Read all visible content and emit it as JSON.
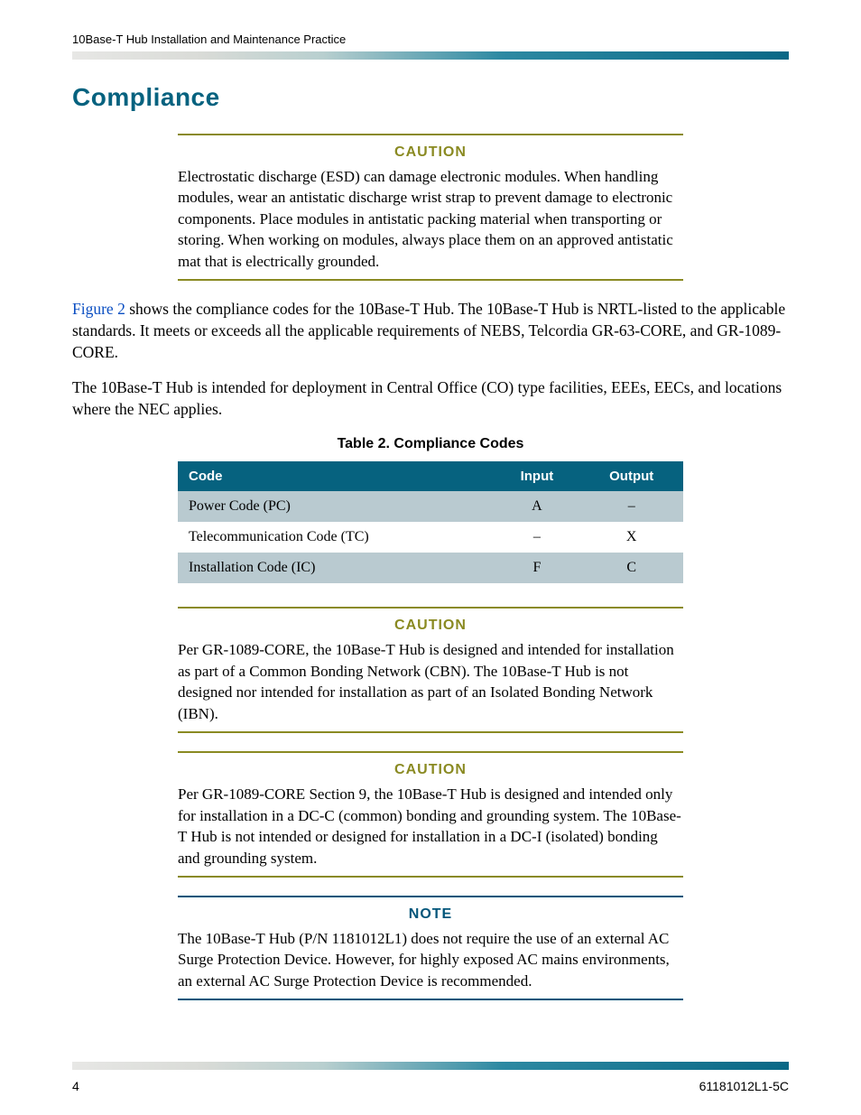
{
  "header": {
    "running": "10Base-T Hub Installation and Maintenance Practice"
  },
  "section_title": "Compliance",
  "caution1": {
    "label": "CAUTION",
    "body": "Electrostatic discharge (ESD) can damage electronic modules. When handling modules, wear an antistatic discharge wrist strap to prevent damage to electronic components. Place modules in antistatic packing material when transporting or storing. When working on modules, always place them on an approved antistatic mat that is electrically grounded."
  },
  "para1": {
    "figref": "Figure 2",
    "rest": " shows the compliance codes for the 10Base-T Hub. The 10Base-T Hub is NRTL-listed to the applicable standards. It meets or exceeds all the applicable requirements of NEBS, Telcordia GR-63-CORE, and GR-1089-CORE."
  },
  "para2": "The 10Base-T Hub is intended for deployment in Central Office (CO) type facilities, EEEs, EECs, and locations where the NEC applies.",
  "table": {
    "title": "Table 2.  Compliance Codes",
    "headers": {
      "code": "Code",
      "input": "Input",
      "output": "Output"
    },
    "rows": [
      {
        "code": "Power Code (PC)",
        "input": "A",
        "output": "–"
      },
      {
        "code": "Telecommunication Code (TC)",
        "input": "–",
        "output": "X"
      },
      {
        "code": "Installation Code (IC)",
        "input": "F",
        "output": "C"
      }
    ]
  },
  "caution2": {
    "label": "CAUTION",
    "body": "Per GR-1089-CORE, the 10Base-T Hub is designed and intended for installation as part of a Common Bonding Network (CBN). The 10Base-T Hub is not designed nor intended for installation as part of an Isolated Bonding Network (IBN)."
  },
  "caution3": {
    "label": "CAUTION",
    "body": "Per GR-1089-CORE Section 9, the 10Base-T Hub is designed and intended only for installation in a DC-C (common) bonding and grounding system. The 10Base-T Hub is not intended or designed for installation in a DC-I (isolated) bonding and grounding system."
  },
  "note1": {
    "label": "NOTE",
    "body": "The 10Base-T Hub (P/N 1181012L1) does not require the use of an external AC Surge Protection Device. However, for highly exposed AC mains environments, an external AC Surge Protection Device is recommended."
  },
  "footer": {
    "page": "4",
    "docnum": "61181012L1-5C"
  },
  "chart_data": {
    "type": "table",
    "title": "Table 2. Compliance Codes",
    "columns": [
      "Code",
      "Input",
      "Output"
    ],
    "rows": [
      [
        "Power Code (PC)",
        "A",
        "–"
      ],
      [
        "Telecommunication Code (TC)",
        "–",
        "X"
      ],
      [
        "Installation Code (IC)",
        "F",
        "C"
      ]
    ]
  }
}
